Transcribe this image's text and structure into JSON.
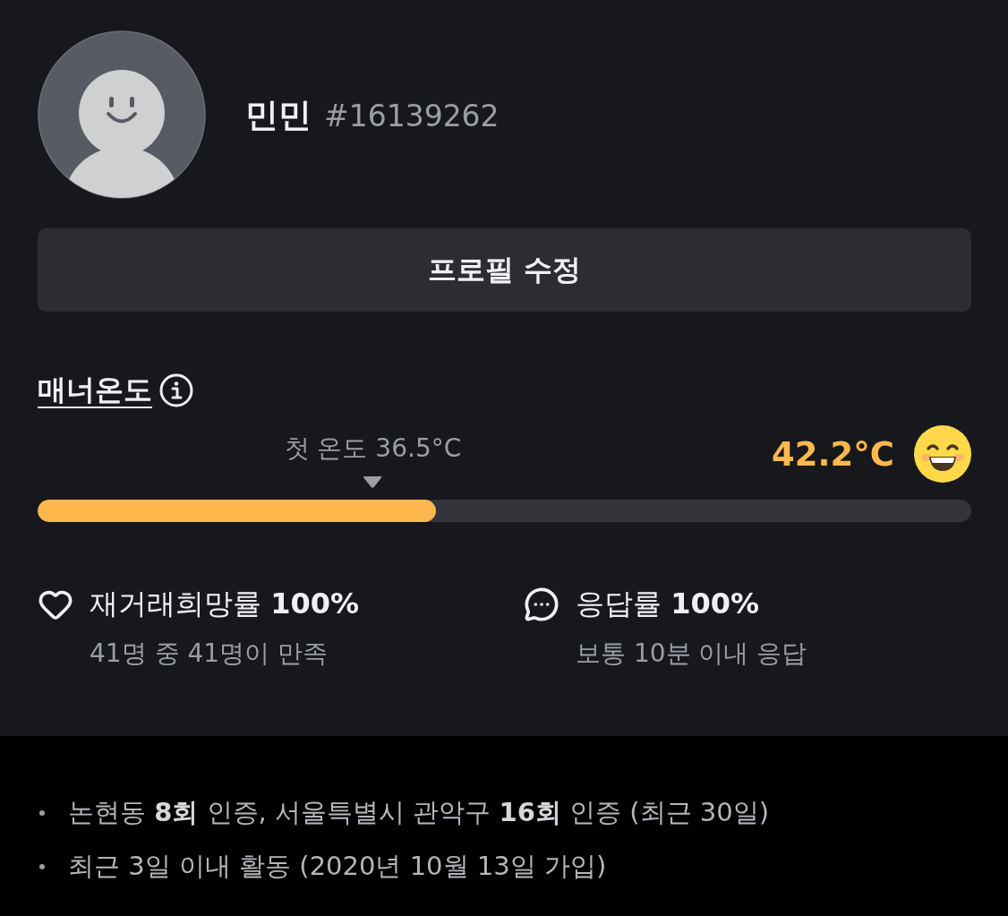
{
  "profile": {
    "name": "민민",
    "user_id": "#16139262"
  },
  "edit_button": {
    "label": "프로필 수정"
  },
  "manner_temperature": {
    "title": "매너온도",
    "first_temperature": {
      "label": "첫 온도 36.5°C",
      "level": 0.359
    },
    "reading": "42.2°C",
    "level": 0.427
  },
  "stats": [
    {
      "kind": "heart",
      "title": "재거래희망률 **100%**",
      "detail": "41명 중 41명이 만족"
    },
    {
      "kind": "chat",
      "title": "응답률 **100%**",
      "detail": "보통 10분 이내 응답"
    }
  ],
  "activity": [
    "논현동 **8회** 인증, 서울특별시 관악구 **16회** 인증 (최근 30일)",
    "최근 3일 이내 활동 (2020년 10월 13일 가입)"
  ]
}
